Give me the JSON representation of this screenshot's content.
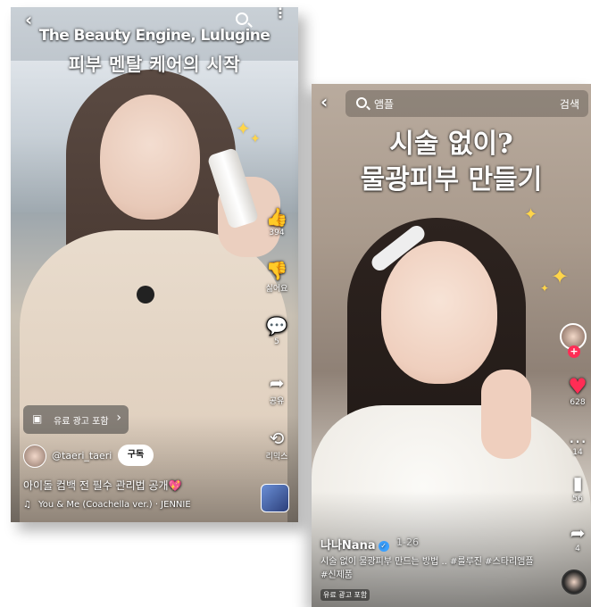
{
  "left_video": {
    "title_line1": "The Beauty Engine, Lulugine",
    "title_line2": "피부 멘탈 케어의 시작",
    "back_icon": "‹",
    "more_icon": "⋮",
    "actions": {
      "like": {
        "icon": "👍",
        "count": "394"
      },
      "dislike": {
        "icon": "👎",
        "label": "싫어요"
      },
      "comment": {
        "icon": "💬",
        "count": "5"
      },
      "share": {
        "icon": "➦",
        "label": "공유"
      },
      "remix": {
        "icon": "⟲",
        "label": "리믹스"
      }
    },
    "ad_chip": {
      "icon": "▣",
      "label": "유료 광고 포함",
      "arrow": "›"
    },
    "channel_handle": "@taeri_taeri",
    "subscribe_label": "구독",
    "caption": "아이돌 컴백 전 필수 관리법 공개💖",
    "music_icon": "♫",
    "music_track": "You & Me (Coachella ver.) · JENNIE"
  },
  "right_video": {
    "back_icon": "‹",
    "search": {
      "query": "앰플",
      "button_label": "검색"
    },
    "title_line1": "시술 없이?",
    "title_line2": "물광피부 만들기",
    "follow_icon": "+",
    "actions": {
      "like": {
        "icon": "♥",
        "count": "628"
      },
      "comment": {
        "icon": "…",
        "count": "14"
      },
      "save": {
        "icon": "▮",
        "count": "56"
      },
      "share": {
        "icon": "➦",
        "count": "4"
      }
    },
    "creator_name": "나나Nana",
    "verified_icon": "✓",
    "post_date": "1-26",
    "caption": "시술 없이 물광피부 만드는 방법 .. #룰루진 #스타리앰플 #신제품",
    "ad_label": "유료 광고 포함"
  },
  "colors": {
    "like_red": "#ff2d55",
    "sparkle": "#ffd54a",
    "verified_blue": "#3aa0ff"
  }
}
